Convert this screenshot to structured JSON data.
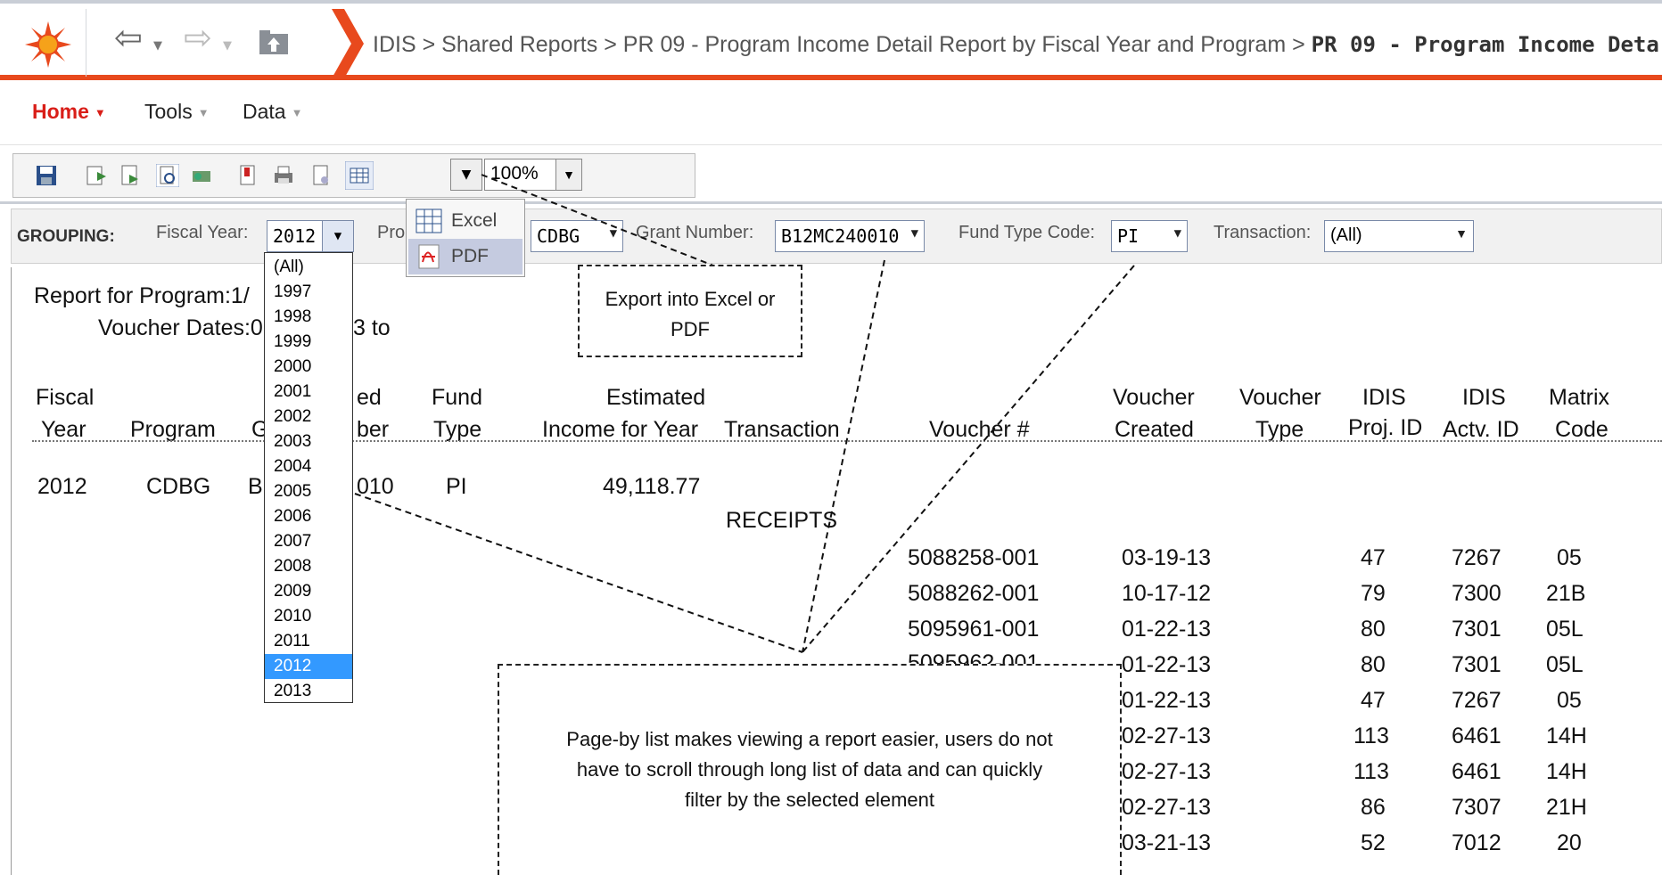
{
  "breadcrumb": {
    "items": [
      "IDIS",
      "Shared Reports",
      "PR 09 - Program Income Detail Report by Fiscal Year and Program"
    ],
    "separator": ">",
    "current": "PR 09 - Program Income Deta"
  },
  "menubar": {
    "home": "Home",
    "tools": "Tools",
    "data": "Data"
  },
  "toolbar": {
    "icons": [
      "save-icon",
      "export-icon",
      "page-icon",
      "preview-icon",
      "print-pdf-icon",
      "bookmark-icon",
      "printer-icon",
      "document-icon",
      "export-grid-icon",
      "help-icon",
      "resize-icon"
    ],
    "zoom": "100%"
  },
  "export_menu": {
    "excel": "Excel",
    "pdf": "PDF"
  },
  "grouping": {
    "label": "GROUPING:",
    "fiscal_year_label": "Fiscal Year:",
    "fiscal_year_value": "2012",
    "program_label": "Pro",
    "program_value": "CDBG",
    "grant_label": "Grant Number:",
    "grant_value": "B12MC240010",
    "fund_label": "Fund Type Code:",
    "fund_value": "PI",
    "transaction_label": "Transaction:",
    "transaction_value": "(All)"
  },
  "fiscal_year_options": [
    "(All)",
    "1997",
    "1998",
    "1999",
    "2000",
    "2001",
    "2002",
    "2003",
    "2004",
    "2005",
    "2006",
    "2007",
    "2008",
    "2009",
    "2010",
    "2011",
    "2012",
    "2013"
  ],
  "report": {
    "title_line1": "Report for Program:1/",
    "title_line2": "Voucher Dates:0",
    "title_line2_tail": "3 to",
    "headers": {
      "fiscal": [
        "Fiscal",
        "Year"
      ],
      "program": "Program",
      "grant_partial": "G",
      "auth_partial": [
        "ed",
        "ber"
      ],
      "fund": [
        "Fund",
        "Type"
      ],
      "estimated": [
        "Estimated",
        "Income for Year"
      ],
      "transaction": "Transaction",
      "voucher_no": "Voucher #",
      "voucher_created": [
        "Voucher",
        "Created"
      ],
      "voucher_type": [
        "Voucher",
        "Type"
      ],
      "proj_id": [
        "IDIS",
        "Proj. ID"
      ],
      "actv_id": [
        "IDIS",
        "Actv. ID"
      ],
      "matrix": [
        "Matrix",
        "Code"
      ]
    },
    "summary_row": {
      "year": "2012",
      "program": "CDBG",
      "grant": "B",
      "number_tail": "010",
      "fund": "PI",
      "estimated": "49,118.77"
    },
    "transaction_label": "RECEIPTS",
    "rows": [
      {
        "voucher": "5088258-001",
        "created": "03-19-13",
        "proj": "47",
        "actv": "7267",
        "matrix": "05"
      },
      {
        "voucher": "5088262-001",
        "created": "10-17-12",
        "proj": "79",
        "actv": "7300",
        "matrix": "21B"
      },
      {
        "voucher": "5095961-001",
        "created": "01-22-13",
        "proj": "80",
        "actv": "7301",
        "matrix": "05L"
      },
      {
        "voucher": "5095962-001",
        "created": "01-22-13",
        "proj": "80",
        "actv": "7301",
        "matrix": "05L"
      },
      {
        "voucher": "",
        "created": "01-22-13",
        "proj": "47",
        "actv": "7267",
        "matrix": "05"
      },
      {
        "voucher": "",
        "created": "02-27-13",
        "proj": "113",
        "actv": "6461",
        "matrix": "14H"
      },
      {
        "voucher": "",
        "created": "02-27-13",
        "proj": "113",
        "actv": "6461",
        "matrix": "14H"
      },
      {
        "voucher": "",
        "created": "02-27-13",
        "proj": "86",
        "actv": "7307",
        "matrix": "21H"
      },
      {
        "voucher": "",
        "created": "03-21-13",
        "proj": "52",
        "actv": "7012",
        "matrix": "20"
      }
    ]
  },
  "callouts": {
    "export": "Export into Excel or PDF",
    "pageby": "Page-by list makes viewing a report easier, users do not have to scroll through long list of data and can quickly filter by the selected element"
  },
  "colors": {
    "accent": "#e8491d",
    "home_red": "#d91e18",
    "selected": "#3399ff"
  }
}
